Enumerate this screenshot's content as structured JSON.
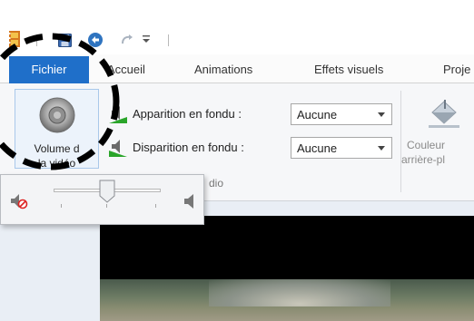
{
  "quick_access": {
    "icons": [
      "film-app-icon",
      "save-icon",
      "undo-icon",
      "redo-icon",
      "customize-dropdown-icon"
    ]
  },
  "tabs": {
    "file": "Fichier",
    "home": "Accueil",
    "animations": "Animations",
    "visual_effects": "Effets visuels",
    "project": "Proje"
  },
  "ribbon": {
    "volume_button": {
      "line1": "Volume d",
      "line2": "la vidéo"
    },
    "fade_in": {
      "label": "Apparition en fondu :",
      "value": "Aucune"
    },
    "fade_out": {
      "label": "Disparition en fondu :",
      "value": "Aucune"
    },
    "group_label": "dio",
    "background_color": {
      "line1": "Couleur",
      "line2": "arrière-pl"
    }
  },
  "volume_popup": {
    "level": 0.5
  },
  "colors": {
    "accent": "#1f6fc9",
    "annotation": "#000000"
  }
}
